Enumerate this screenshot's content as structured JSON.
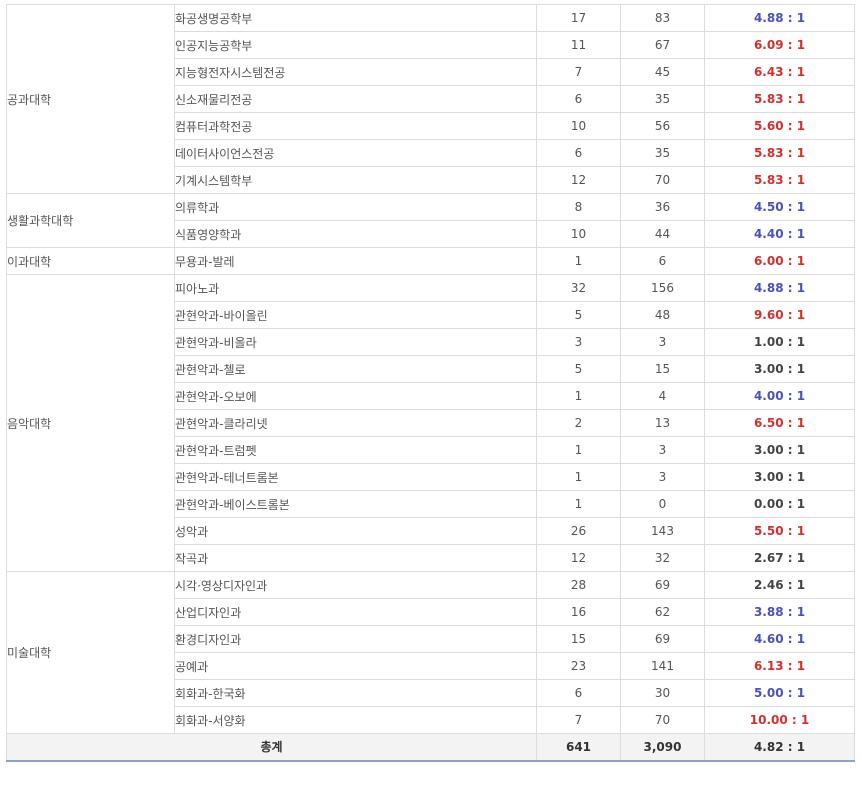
{
  "groups": [
    {
      "college": "공과대학",
      "rows": [
        {
          "dept": "화공생명공학부",
          "quota": "17",
          "applicants": "83",
          "ratio": "4.88 : 1",
          "level": "lo"
        },
        {
          "dept": "인공지능공학부",
          "quota": "11",
          "applicants": "67",
          "ratio": "6.09 : 1",
          "level": "hi"
        },
        {
          "dept": "지능형전자시스템전공",
          "quota": "7",
          "applicants": "45",
          "ratio": "6.43 : 1",
          "level": "hi"
        },
        {
          "dept": "신소재물리전공",
          "quota": "6",
          "applicants": "35",
          "ratio": "5.83 : 1",
          "level": "hi"
        },
        {
          "dept": "컴퓨터과학전공",
          "quota": "10",
          "applicants": "56",
          "ratio": "5.60 : 1",
          "level": "hi"
        },
        {
          "dept": "데이터사이언스전공",
          "quota": "6",
          "applicants": "35",
          "ratio": "5.83 : 1",
          "level": "hi"
        },
        {
          "dept": "기계시스템학부",
          "quota": "12",
          "applicants": "70",
          "ratio": "5.83 : 1",
          "level": "hi"
        }
      ]
    },
    {
      "college": "생활과학대학",
      "rows": [
        {
          "dept": "의류학과",
          "quota": "8",
          "applicants": "36",
          "ratio": "4.50 : 1",
          "level": "lo"
        },
        {
          "dept": "식품영양학과",
          "quota": "10",
          "applicants": "44",
          "ratio": "4.40 : 1",
          "level": "lo"
        }
      ]
    },
    {
      "college": "이과대학",
      "rows": [
        {
          "dept": "무용과-발레",
          "quota": "1",
          "applicants": "6",
          "ratio": "6.00 : 1",
          "level": "hi"
        }
      ]
    },
    {
      "college": "음악대학",
      "rows": [
        {
          "dept": "피아노과",
          "quota": "32",
          "applicants": "156",
          "ratio": "4.88 : 1",
          "level": "lo"
        },
        {
          "dept": "관현악과-바이올린",
          "quota": "5",
          "applicants": "48",
          "ratio": "9.60 : 1",
          "level": "hi"
        },
        {
          "dept": "관현악과-비올라",
          "quota": "3",
          "applicants": "3",
          "ratio": "1.00 : 1",
          "level": "mid"
        },
        {
          "dept": "관현악과-첼로",
          "quota": "5",
          "applicants": "15",
          "ratio": "3.00 : 1",
          "level": "mid"
        },
        {
          "dept": "관현악과-오보에",
          "quota": "1",
          "applicants": "4",
          "ratio": "4.00 : 1",
          "level": "lo"
        },
        {
          "dept": "관현악과-클라리넷",
          "quota": "2",
          "applicants": "13",
          "ratio": "6.50 : 1",
          "level": "hi"
        },
        {
          "dept": "관현악과-트럼펫",
          "quota": "1",
          "applicants": "3",
          "ratio": "3.00 : 1",
          "level": "mid"
        },
        {
          "dept": "관현악과-테너트롬본",
          "quota": "1",
          "applicants": "3",
          "ratio": "3.00 : 1",
          "level": "mid"
        },
        {
          "dept": "관현악과-베이스트롬본",
          "quota": "1",
          "applicants": "0",
          "ratio": "0.00 : 1",
          "level": "mid"
        },
        {
          "dept": "성악과",
          "quota": "26",
          "applicants": "143",
          "ratio": "5.50 : 1",
          "level": "hi"
        },
        {
          "dept": "작곡과",
          "quota": "12",
          "applicants": "32",
          "ratio": "2.67 : 1",
          "level": "mid"
        }
      ]
    },
    {
      "college": "미술대학",
      "rows": [
        {
          "dept": "시각·영상디자인과",
          "quota": "28",
          "applicants": "69",
          "ratio": "2.46 : 1",
          "level": "mid"
        },
        {
          "dept": "산업디자인과",
          "quota": "16",
          "applicants": "62",
          "ratio": "3.88 : 1",
          "level": "lo"
        },
        {
          "dept": "환경디자인과",
          "quota": "15",
          "applicants": "69",
          "ratio": "4.60 : 1",
          "level": "lo"
        },
        {
          "dept": "공예과",
          "quota": "23",
          "applicants": "141",
          "ratio": "6.13 : 1",
          "level": "hi"
        },
        {
          "dept": "회화과-한국화",
          "quota": "6",
          "applicants": "30",
          "ratio": "5.00 : 1",
          "level": "lo"
        },
        {
          "dept": "회화과-서양화",
          "quota": "7",
          "applicants": "70",
          "ratio": "10.00 : 1",
          "level": "hi"
        }
      ]
    }
  ],
  "total": {
    "label": "총계",
    "quota": "641",
    "applicants": "3,090",
    "ratio": "4.82 : 1"
  },
  "colors": {
    "hi": "#d22f2f",
    "lo": "#4a52b5",
    "mid": "#444444",
    "total_underline": "#8ea2c8"
  }
}
